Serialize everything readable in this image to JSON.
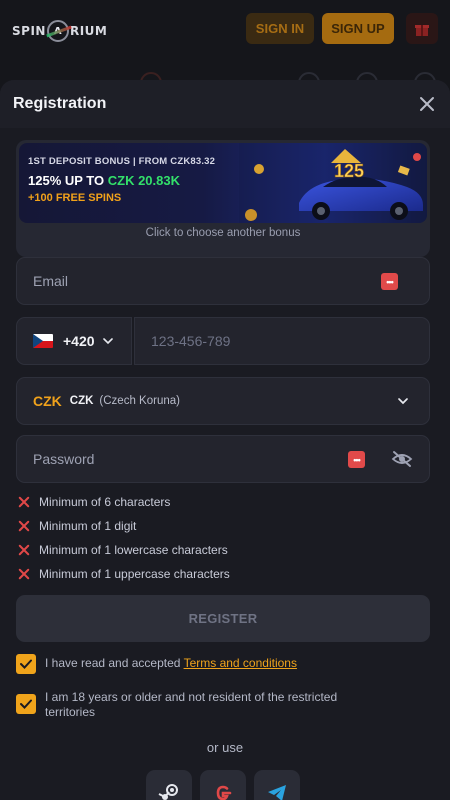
{
  "app": {
    "logo_text_left": "SPIN",
    "logo_mark": "A",
    "logo_text_right": "RIUM"
  },
  "topbar": {
    "signin_label": "SIGN IN",
    "signup_label": "SIGN UP",
    "gift_icon": "gift-icon"
  },
  "modal": {
    "title": "Registration",
    "close_icon": "close-icon"
  },
  "bonus": {
    "line1": "1ST DEPOSIT BONUS | FROM CZK83.32",
    "line2_prefix": "125% UP TO ",
    "line2_amount": "CZK 20.83K",
    "line3": "+100 FREE SPINS",
    "art_text": "125",
    "hint": "Click to choose another bonus"
  },
  "form": {
    "email_placeholder": "Email",
    "phone_code": "+420",
    "phone_placeholder": "123-456-789",
    "currency_code": "CZK",
    "currency_code_small": "CZK",
    "currency_name": "(Czech Koruna)",
    "password_placeholder": "Password",
    "rules": [
      "Minimum of 6 characters",
      "Minimum of 1 digit",
      "Minimum of 1 lowercase characters",
      "Minimum of 1 uppercase characters"
    ],
    "register_label": "REGISTER",
    "terms_prefix": "I have read and accepted ",
    "terms_link": "Terms and conditions",
    "age_text": "I am 18 years or older and not resident of the restricted territories",
    "or_use": "or use"
  },
  "colors": {
    "accent": "#f0a41b",
    "error": "#e04848",
    "green": "#33e06a"
  }
}
